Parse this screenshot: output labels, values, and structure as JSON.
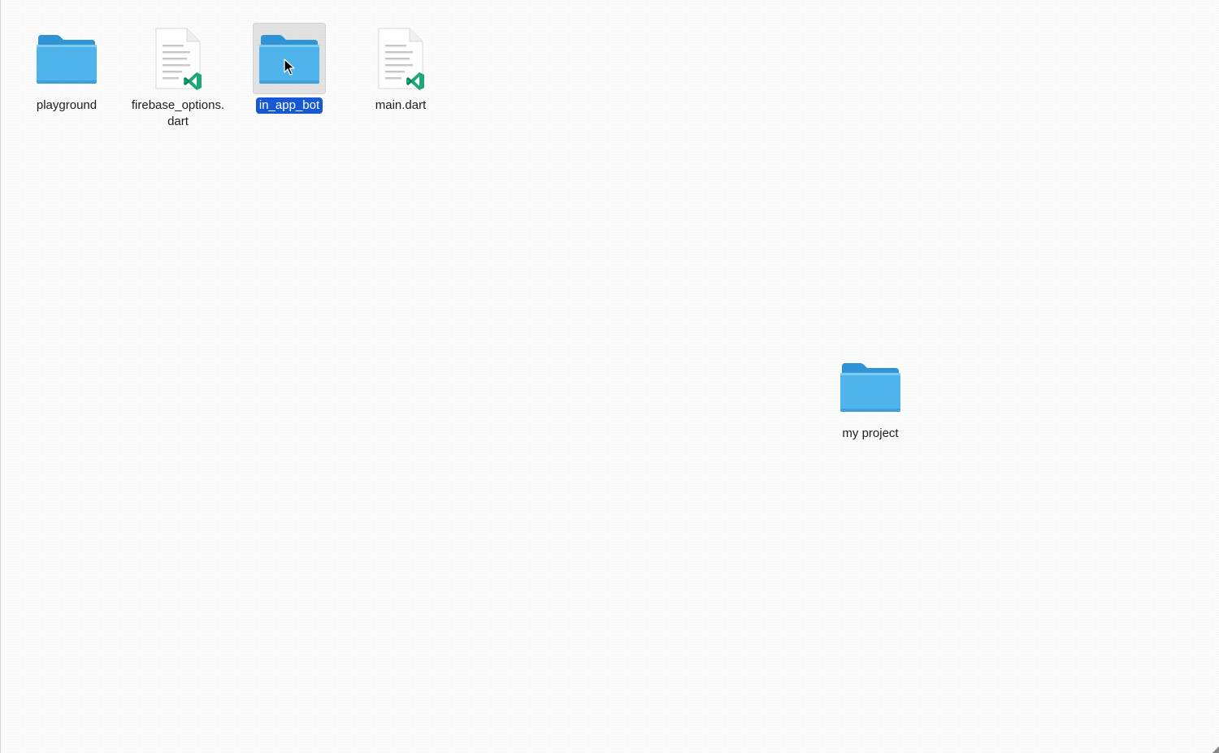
{
  "desktop": {
    "items": [
      {
        "name": "playground",
        "kind": "folder",
        "selected": false
      },
      {
        "name": "firebase_options.\ndart",
        "kind": "dart-file",
        "selected": false
      },
      {
        "name": "in_app_bot",
        "kind": "folder",
        "selected": true
      },
      {
        "name": "main.dart",
        "kind": "dart-file",
        "selected": false
      },
      {
        "name": "my project",
        "kind": "folder",
        "selected": false
      }
    ]
  },
  "colors": {
    "folder_body": "#4fb3ec",
    "folder_tab": "#2f93d6",
    "selection": "#1659d2",
    "vscode_accent": "#1fa67a"
  },
  "icons": {
    "folder": "folder-icon",
    "dart_file": "vscode-document-icon",
    "cursor": "mouse-pointer-icon"
  }
}
